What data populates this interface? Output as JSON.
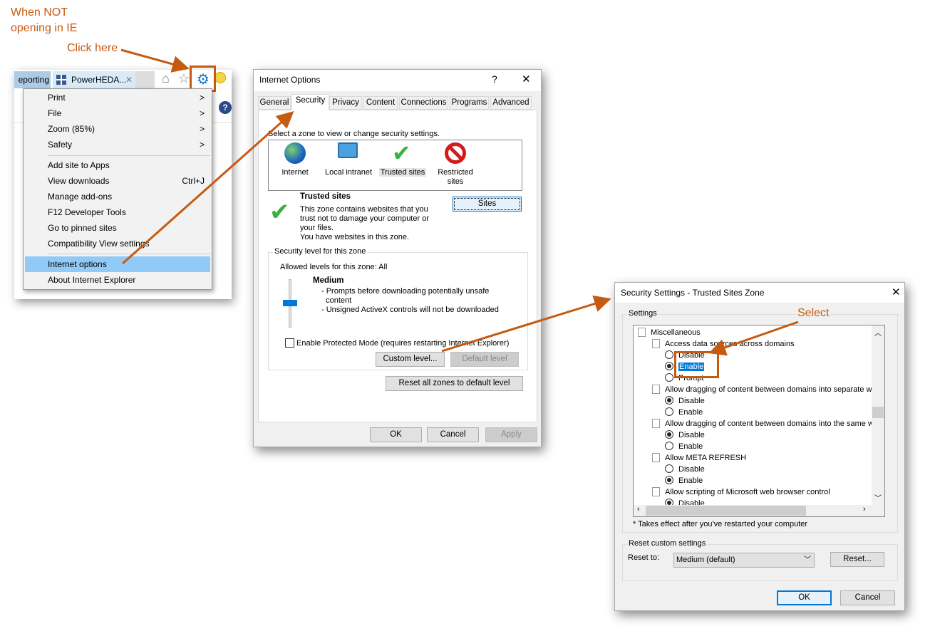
{
  "annotations": {
    "note": "When NOT\nopening in IE",
    "click_here": "Click here",
    "select": "Select",
    "accent": "#c55a11"
  },
  "browser": {
    "tabs": [
      "eporting",
      "PowerHEDA..."
    ],
    "menu": {
      "items": [
        {
          "label": "Print",
          "right": ">"
        },
        {
          "label": "File",
          "right": ">"
        },
        {
          "label": "Zoom (85%)",
          "right": ">"
        },
        {
          "label": "Safety",
          "right": ">"
        },
        {
          "label": "Add site to Apps",
          "right": ""
        },
        {
          "label": "View downloads",
          "right": "Ctrl+J"
        },
        {
          "label": "Manage add-ons",
          "right": ""
        },
        {
          "label": "F12 Developer Tools",
          "right": ""
        },
        {
          "label": "Go to pinned sites",
          "right": ""
        },
        {
          "label": "Compatibility View settings",
          "right": ""
        },
        {
          "label": "Internet options",
          "right": "",
          "highlighted": true
        },
        {
          "label": "About Internet Explorer",
          "right": ""
        }
      ]
    }
  },
  "internet_options": {
    "title": "Internet Options",
    "help": "?",
    "close": "✕",
    "tabs": [
      "General",
      "Security",
      "Privacy",
      "Content",
      "Connections",
      "Programs",
      "Advanced"
    ],
    "active_tab": "Security",
    "zone_prompt": "Select a zone to view or change security settings.",
    "zones": [
      "Internet",
      "Local intranet",
      "Trusted sites",
      "Restricted\nsites"
    ],
    "selected_zone": "Trusted sites",
    "zone_title": "Trusted sites",
    "zone_desc": "This zone contains websites that you\ntrust not to damage your computer or\nyour files.\nYou have websites in this zone.",
    "sites_button": "Sites",
    "level_group": "Security level for this zone",
    "allowed": "Allowed levels for this zone: All",
    "level_name": "Medium",
    "level_desc": "- Prompts before downloading potentially unsafe\n  content\n- Unsigned ActiveX controls will not be downloaded",
    "protected_mode": "Enable Protected Mode (requires restarting Internet Explorer)",
    "protected_mode_checked": false,
    "custom_level": "Custom level...",
    "default_level": "Default level",
    "reset_all": "Reset all zones to default level",
    "ok": "OK",
    "cancel": "Cancel",
    "apply": "Apply"
  },
  "security_settings": {
    "title": "Security Settings - Trusted Sites Zone",
    "close": "✕",
    "settings_group": "Settings",
    "rows": [
      {
        "type": "doc",
        "indent": 0,
        "label": "Miscellaneous"
      },
      {
        "type": "doc",
        "indent": 1,
        "label": "Access data sources across domains"
      },
      {
        "type": "radio",
        "checked": false,
        "label": "Disable"
      },
      {
        "type": "radio",
        "checked": true,
        "label": "Enable",
        "selected": true
      },
      {
        "type": "radio",
        "checked": false,
        "label": "Prompt"
      },
      {
        "type": "doc",
        "indent": 1,
        "label": "Allow dragging of content between domains into separate wi"
      },
      {
        "type": "radio",
        "checked": true,
        "label": "Disable"
      },
      {
        "type": "radio",
        "checked": false,
        "label": "Enable"
      },
      {
        "type": "doc",
        "indent": 1,
        "label": "Allow dragging of content between domains into the same wi"
      },
      {
        "type": "radio",
        "checked": true,
        "label": "Disable"
      },
      {
        "type": "radio",
        "checked": false,
        "label": "Enable"
      },
      {
        "type": "doc",
        "indent": 1,
        "label": "Allow META REFRESH"
      },
      {
        "type": "radio",
        "checked": false,
        "label": "Disable"
      },
      {
        "type": "radio",
        "checked": true,
        "label": "Enable"
      },
      {
        "type": "doc",
        "indent": 1,
        "label": "Allow scripting of Microsoft web browser control"
      },
      {
        "type": "radio",
        "checked": true,
        "label": "Disable"
      }
    ],
    "note": "* Takes effect after you've restarted your computer",
    "reset_group": "Reset custom settings",
    "reset_to": "Reset to:",
    "reset_value": "Medium (default)",
    "reset_button": "Reset...",
    "ok": "OK",
    "cancel": "Cancel"
  }
}
